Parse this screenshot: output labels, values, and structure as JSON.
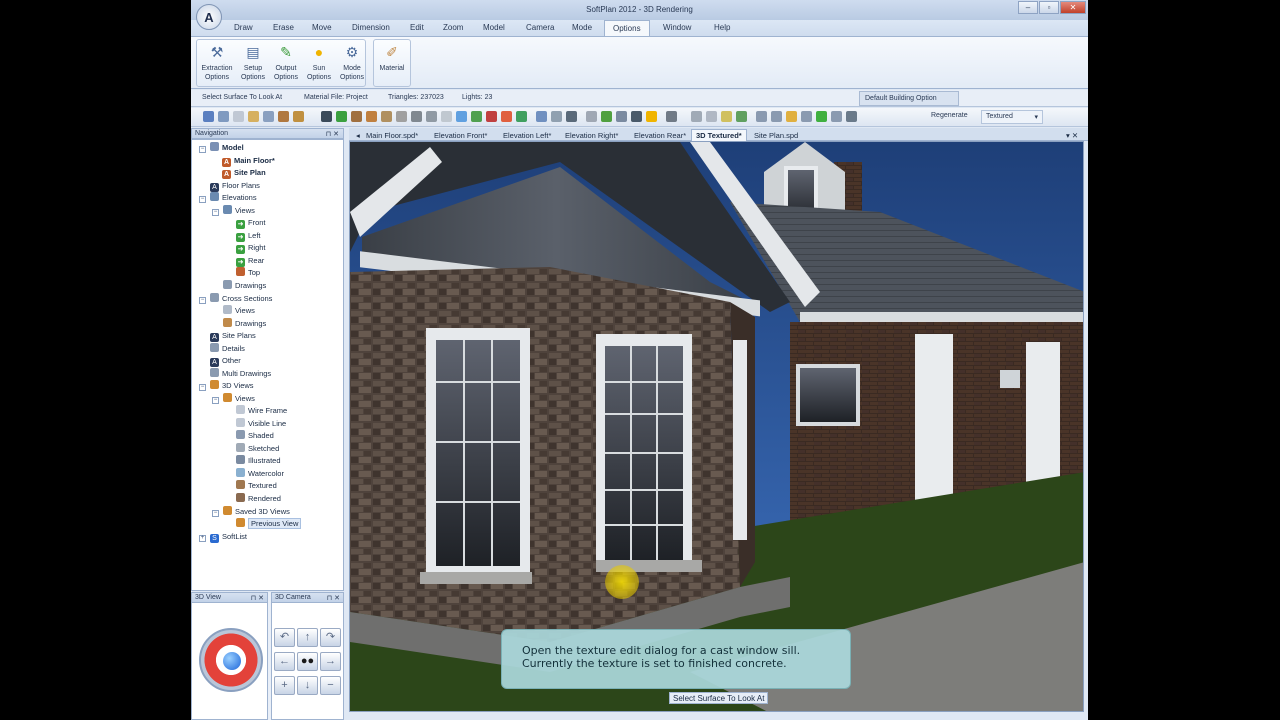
{
  "window": {
    "title": "SoftPlan 2012 - 3D Rendering",
    "logo_letter": "A",
    "controls": [
      "–",
      "▫",
      "✕"
    ]
  },
  "menu": {
    "items": [
      "Draw",
      "Erase",
      "Move",
      "Dimension",
      "Edit",
      "Zoom",
      "Model",
      "Camera",
      "Mode",
      "Options",
      "Window",
      "Help"
    ],
    "active": "Options"
  },
  "ribbon": {
    "options_group": [
      {
        "line1": "Extraction",
        "line2": "Options"
      },
      {
        "line1": "Setup",
        "line2": "Options"
      },
      {
        "line1": "Output",
        "line2": "Options"
      },
      {
        "line1": "Sun",
        "line2": "Options"
      },
      {
        "line1": "Mode",
        "line2": "Options"
      }
    ],
    "material_label": "Material"
  },
  "status_row": {
    "hint": "Select Surface To Look At",
    "material_file": "Material File: Project",
    "triangles": "Triangles: 237023",
    "lights": "Lights: 23",
    "default_option": "Default Building Option"
  },
  "toolbar": {
    "regenerate": "Regenerate",
    "mode_select": "Textured",
    "mode_caret": "▾"
  },
  "navigation": {
    "title": "Navigation",
    "pin": "⊓ ✕",
    "tree": [
      {
        "label": "Model",
        "bold": true
      },
      {
        "label": "Main Floor*",
        "bold": true
      },
      {
        "label": "Site Plan",
        "bold": true
      },
      {
        "label": "Floor Plans"
      },
      {
        "label": "Elevations"
      },
      {
        "label": "Views"
      },
      {
        "label": "Front"
      },
      {
        "label": "Left"
      },
      {
        "label": "Right"
      },
      {
        "label": "Rear"
      },
      {
        "label": "Top"
      },
      {
        "label": "Drawings"
      },
      {
        "label": "Cross Sections"
      },
      {
        "label": "Views"
      },
      {
        "label": "Drawings"
      },
      {
        "label": "Site Plans"
      },
      {
        "label": "Details"
      },
      {
        "label": "Other"
      },
      {
        "label": "Multi Drawings"
      },
      {
        "label": "3D Views"
      },
      {
        "label": "Views"
      },
      {
        "label": "Wire Frame"
      },
      {
        "label": "Visible Line"
      },
      {
        "label": "Shaded"
      },
      {
        "label": "Sketched"
      },
      {
        "label": "Illustrated"
      },
      {
        "label": "Watercolor"
      },
      {
        "label": "Textured"
      },
      {
        "label": "Rendered"
      },
      {
        "label": "Saved 3D Views"
      },
      {
        "label": "Previous View"
      },
      {
        "label": "SoftList"
      }
    ]
  },
  "panels": {
    "view3d_title": "3D View",
    "camera3d_title": "3D Camera",
    "pin": "⊓ ✕"
  },
  "doc_tabs": {
    "tabs": [
      "Main Floor.spd*",
      "Elevation Front*",
      "Elevation Left*",
      "Elevation Right*",
      "Elevation Rear*",
      "3D Textured*",
      "Site Plan.spd"
    ],
    "active": "3D Textured*",
    "left_arrow": "◂",
    "right_controls": "▾ ✕"
  },
  "viewport": {
    "tooltip_line1": "Open the texture edit dialog for a cast window sill.",
    "tooltip_line2": "Currently the texture is set to finished concrete.",
    "status_text": "Select Surface To Look At"
  },
  "colors": {
    "accent": "#4a6a9a",
    "sky": "#2b5aa0",
    "brick": "#4a3428",
    "stone": "#5a4d45",
    "roof": "#4a4f57",
    "lawn": "#2e4a1c",
    "tooltip_bg": "#aad7da",
    "joystick_red": "#e3423a",
    "joystick_blue": "#1a63d8"
  }
}
